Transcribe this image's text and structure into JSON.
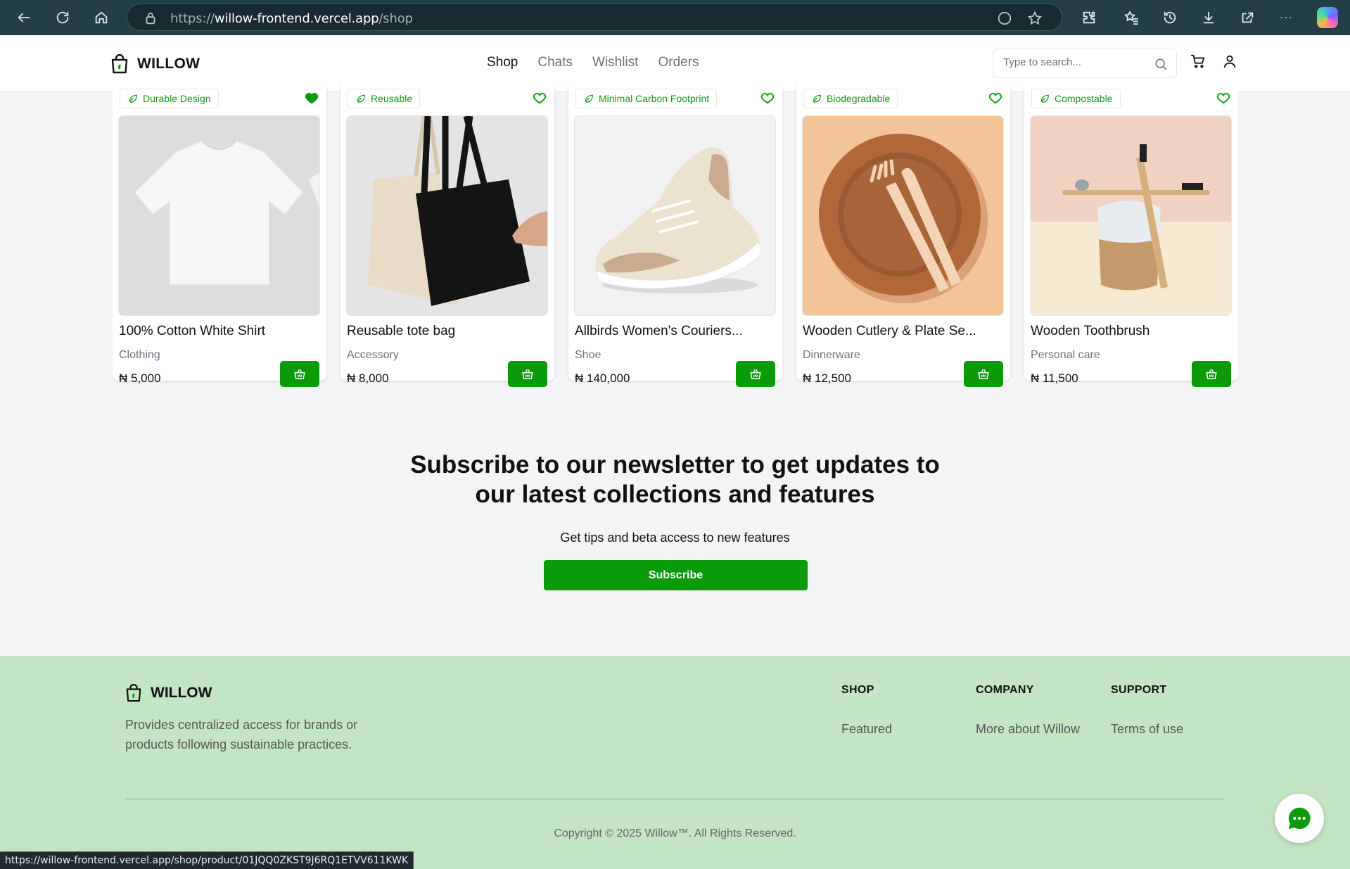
{
  "browser": {
    "url_scheme": "https://",
    "url_host": "willow-frontend.vercel.app",
    "url_path": "/shop",
    "status_url": "https://willow-frontend.vercel.app/shop/product/01JQQ0ZKST9J6RQ1ETVV611KWK"
  },
  "header": {
    "brand": "WILLOW",
    "nav": [
      {
        "label": "Shop",
        "active": true
      },
      {
        "label": "Chats",
        "active": false
      },
      {
        "label": "Wishlist",
        "active": false
      },
      {
        "label": "Orders",
        "active": false
      }
    ],
    "search_placeholder": "Type to search..."
  },
  "products": [
    {
      "tag": "Durable Design",
      "title": "100% Cotton White Shirt",
      "category": "Clothing",
      "price": "₦ 5,000",
      "wishlisted": true
    },
    {
      "tag": "Reusable",
      "title": "Reusable tote bag",
      "category": "Accessory",
      "price": "₦ 8,000",
      "wishlisted": false
    },
    {
      "tag": "Minimal Carbon Footprint",
      "title": "Allbirds Women's Couriers...",
      "category": "Shoe",
      "price": "₦ 140,000",
      "wishlisted": false
    },
    {
      "tag": "Biodegradable",
      "title": "Wooden Cutlery & Plate Se...",
      "category": "Dinnerware",
      "price": "₦ 12,500",
      "wishlisted": false
    },
    {
      "tag": "Compostable",
      "title": "Wooden Toothbrush",
      "category": "Personal care",
      "price": "₦ 11,500",
      "wishlisted": false
    }
  ],
  "newsletter": {
    "heading": "Subscribe to our newsletter to get updates to our latest collections and features",
    "subtext": "Get tips and beta access to new features",
    "button": "Subscribe"
  },
  "footer": {
    "brand": "WILLOW",
    "description": "Provides centralized access for brands or products following sustainable practices.",
    "columns": [
      {
        "heading": "SHOP",
        "link": "Featured"
      },
      {
        "heading": "COMPANY",
        "link": "More about Willow"
      },
      {
        "heading": "SUPPORT",
        "link": "Terms of use"
      }
    ],
    "copyright": "Copyright © 2025 Willow™. All Rights Reserved."
  },
  "colors": {
    "accent": "#0a9a0a",
    "browser_bar": "#243e46",
    "footer_bg": "#c4e5c4"
  }
}
